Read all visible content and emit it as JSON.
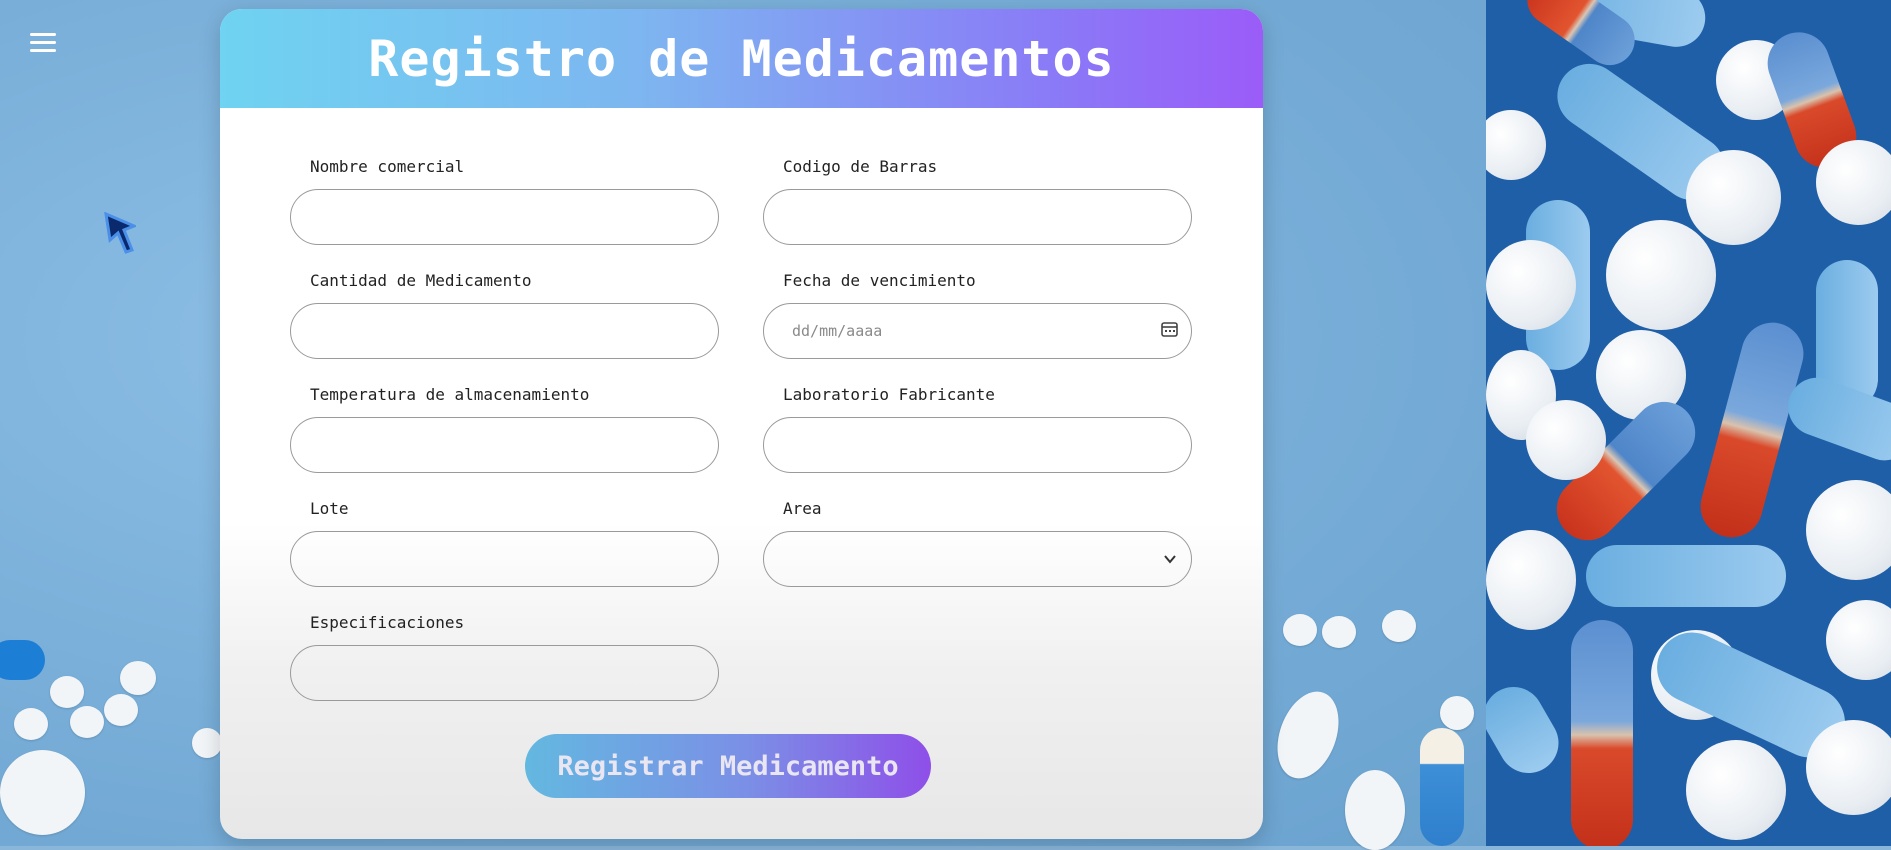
{
  "app": {
    "title": "Registro de Medicamentos"
  },
  "form": {
    "fields": {
      "nombre_comercial": {
        "label": "Nombre comercial",
        "value": ""
      },
      "codigo_barras": {
        "label": "Codigo de Barras",
        "value": ""
      },
      "cantidad": {
        "label": "Cantidad de Medicamento",
        "value": ""
      },
      "fecha_vencimiento": {
        "label": "Fecha de vencimiento",
        "placeholder": "dd/mm/aaaa",
        "value": ""
      },
      "temperatura": {
        "label": "Temperatura de almacenamiento",
        "value": ""
      },
      "laboratorio": {
        "label": "Laboratorio Fabricante",
        "value": ""
      },
      "lote": {
        "label": "Lote",
        "value": ""
      },
      "area": {
        "label": "Area",
        "selected": ""
      },
      "especificaciones": {
        "label": "Especificaciones",
        "value": ""
      }
    },
    "submit_label": "Registrar Medicamento"
  },
  "icons": {
    "menu": "hamburger-menu-icon",
    "calendar": "calendar-icon",
    "chevron": "chevron-down-icon",
    "cursor": "pointer-cursor-icon"
  },
  "colors": {
    "header_gradient_start": "#6fd3f1",
    "header_gradient_end": "#9b5cf8",
    "button_gradient_start": "#63b8e0",
    "button_gradient_end": "#8e4fe8",
    "background": "#78aed8"
  }
}
